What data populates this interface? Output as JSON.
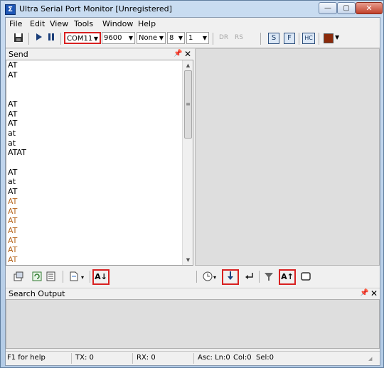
{
  "window": {
    "title": "Ultra Serial Port Monitor [Unregistered]",
    "app_icon_glyph": "Σ",
    "controls": {
      "minimize": "—",
      "maximize": "▢",
      "close": "✕"
    }
  },
  "menu": [
    "File",
    "Edit",
    "View",
    "Tools",
    "Window",
    "Help"
  ],
  "toolbar": {
    "port": "COM11",
    "baud": "9600",
    "parity": "None",
    "databits": "8",
    "stopbits": "1",
    "dr_label": "DR",
    "rs_label": "RS",
    "s_btn": "S",
    "f_btn": "F",
    "hc_btn": "HC",
    "color_swatch": "#8b2a0a",
    "icons": [
      "save-icon",
      "play-icon",
      "pause-icon",
      "send-mode-s-icon",
      "send-mode-f-icon",
      "hex-ascii-icon",
      "color-icon"
    ]
  },
  "send_panel": {
    "title": "Send",
    "pin": "ᵖ",
    "close": "✕",
    "lines": [
      {
        "text": "AT",
        "color": "black"
      },
      {
        "text": "AT",
        "color": "black"
      },
      {
        "text": "",
        "color": "black"
      },
      {
        "text": "",
        "color": "black"
      },
      {
        "text": "AT",
        "color": "black"
      },
      {
        "text": "AT",
        "color": "black"
      },
      {
        "text": "AT",
        "color": "black"
      },
      {
        "text": "at",
        "color": "black"
      },
      {
        "text": "at",
        "color": "black"
      },
      {
        "text": "ATAT",
        "color": "black"
      },
      {
        "text": "",
        "color": "black"
      },
      {
        "text": "AT",
        "color": "black"
      },
      {
        "text": "at",
        "color": "black"
      },
      {
        "text": "AT",
        "color": "black"
      },
      {
        "text": "AT",
        "color": "orange"
      },
      {
        "text": "AT",
        "color": "orange"
      },
      {
        "text": "AT",
        "color": "orange"
      },
      {
        "text": "AT",
        "color": "orange"
      },
      {
        "text": "AT",
        "color": "orange"
      },
      {
        "text": "AT",
        "color": "orange"
      },
      {
        "text": "AT",
        "color": "orange"
      }
    ],
    "scroll_up": "▲",
    "scroll_down": "▼",
    "scroll_grip": "≡"
  },
  "bottom_toolbar": {
    "icons": [
      "properties-icon",
      "refresh-icon",
      "log-icon",
      "file-icon",
      "sort-down-icon",
      "clock-icon",
      "arrow-down-icon",
      "enter-icon",
      "filter-icon",
      "sort-up-icon",
      "window-icon"
    ],
    "sort_down_label": "A↓",
    "sort_up_label": "A↑",
    "dropdown_arrow": "▾"
  },
  "search_panel": {
    "title": "Search Output",
    "pin": "ᵖ",
    "close": "✕"
  },
  "statusbar": {
    "help": "F1 for help",
    "tx": "TX: 0",
    "rx": "RX: 0",
    "asc": "Asc: Ln:0",
    "col": "Col:0",
    "sel": "Sel:0"
  },
  "colors": {
    "highlight_border": "#d82020",
    "orange_text": "#b5651d"
  }
}
